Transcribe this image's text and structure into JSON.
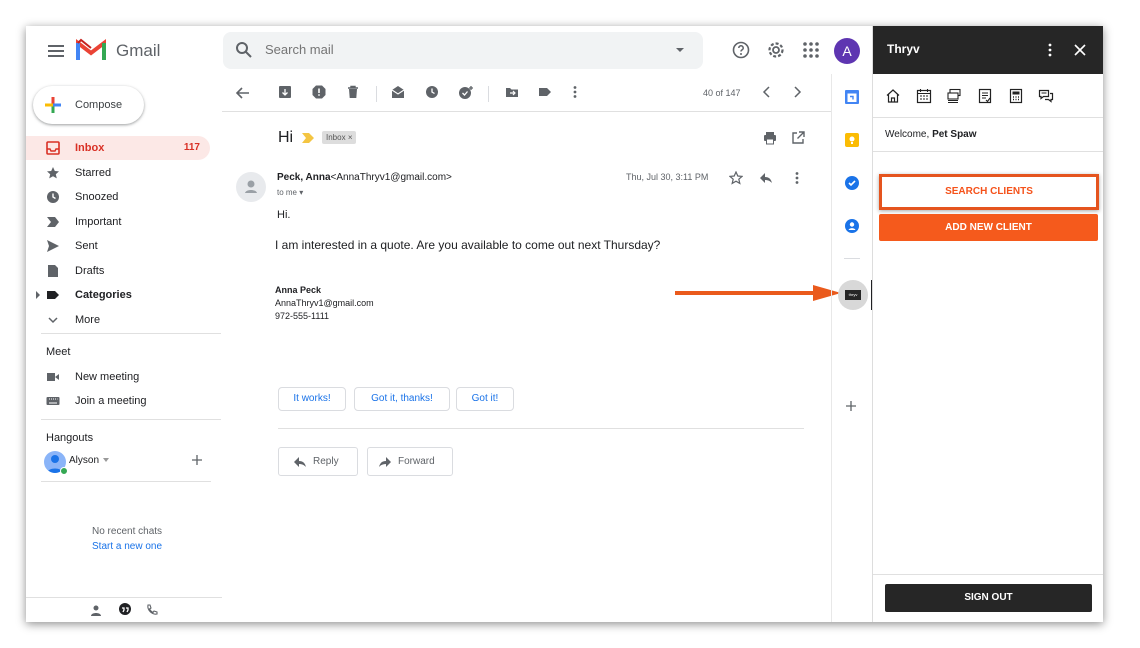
{
  "header": {
    "brand": "Gmail",
    "search_placeholder": "Search mail",
    "avatar_letter": "A"
  },
  "sidebar": {
    "compose_label": "Compose",
    "items": [
      {
        "label": "Inbox",
        "count": "117"
      },
      {
        "label": "Starred"
      },
      {
        "label": "Snoozed"
      },
      {
        "label": "Important"
      },
      {
        "label": "Sent"
      },
      {
        "label": "Drafts"
      },
      {
        "label": "Categories"
      },
      {
        "label": "More"
      }
    ],
    "meet_heading": "Meet",
    "meet_items": [
      "New meeting",
      "Join a meeting"
    ],
    "hangouts_heading": "Hangouts",
    "hangouts_user": "Alyson",
    "no_chats": "No recent chats",
    "start_new": "Start a new one"
  },
  "toolbar": {
    "pagination": "40 of 147"
  },
  "email": {
    "subject": "Hi",
    "label_tag": "Inbox",
    "sender_name": "Peck, Anna",
    "sender_email": "<AnnaThryv1@gmail.com>",
    "to": "to me",
    "date": "Thu, Jul 30, 3:11 PM",
    "greeting": "Hi.",
    "body": "I am interested in a quote. Are you available to come out next Thursday?",
    "signature": [
      "Anna Peck",
      "AnnaThryv1@gmail.com",
      "972-555-1111"
    ]
  },
  "smart_replies": [
    "It works!",
    "Got it, thanks!",
    "Got it!"
  ],
  "actions": {
    "reply": "Reply",
    "forward": "Forward"
  },
  "addon_icon_label": "thryv",
  "panel": {
    "title": "Thryv",
    "welcome_prefix": "Welcome, ",
    "user_name": "Pet Spaw",
    "search_clients": "SEARCH CLIENTS",
    "add_new_client": "ADD NEW CLIENT",
    "sign_out": "SIGN OUT"
  },
  "colors": {
    "accent_orange": "#f55a1c",
    "gmail_red": "#d93025",
    "panel_header": "#262626",
    "link_blue": "#1a73e8"
  }
}
